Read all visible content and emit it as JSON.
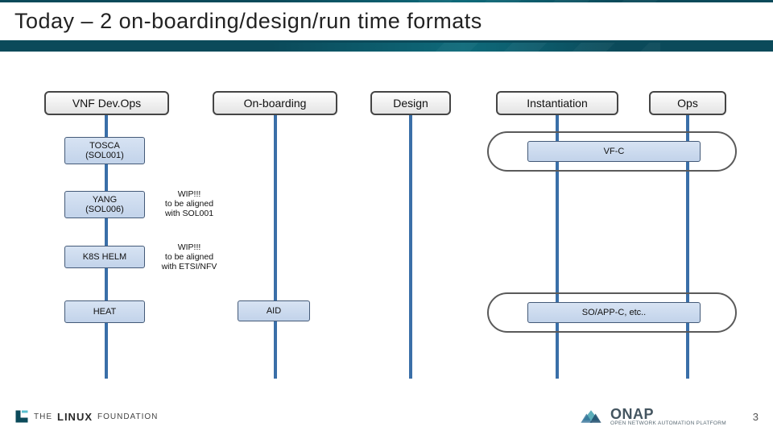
{
  "slide": {
    "title": "Today – 2 on-boarding/design/run time formats",
    "page_number": "3"
  },
  "phases": {
    "vnf_devops": "VNF Dev.Ops",
    "onboarding": "On-boarding",
    "design": "Design",
    "instantiation": "Instantiation",
    "ops": "Ops"
  },
  "rows": {
    "tosca": {
      "label_line1": "TOSCA",
      "label_line2": "(SOL001)",
      "right_label": "VF-C"
    },
    "yang": {
      "label_line1": "YANG",
      "label_line2": "(SOL006)",
      "note_line1": "WIP!!!",
      "note_line2": "to be aligned",
      "note_line3": "with SOL001"
    },
    "k8s": {
      "label": "K8S HELM",
      "note_line1": "WIP!!!",
      "note_line2": "to be aligned",
      "note_line3": "with ETSI/NFV"
    },
    "heat": {
      "label": "HEAT",
      "aid_label": "AID",
      "right_label": "SO/APP-C, etc.."
    }
  },
  "footer": {
    "linux_foundation_prefix": "THE",
    "linux_foundation_main": "LINUX",
    "linux_foundation_suffix": "FOUNDATION",
    "onap_top": "ONAP",
    "onap_sub": "OPEN NETWORK AUTOMATION PLATFORM"
  }
}
